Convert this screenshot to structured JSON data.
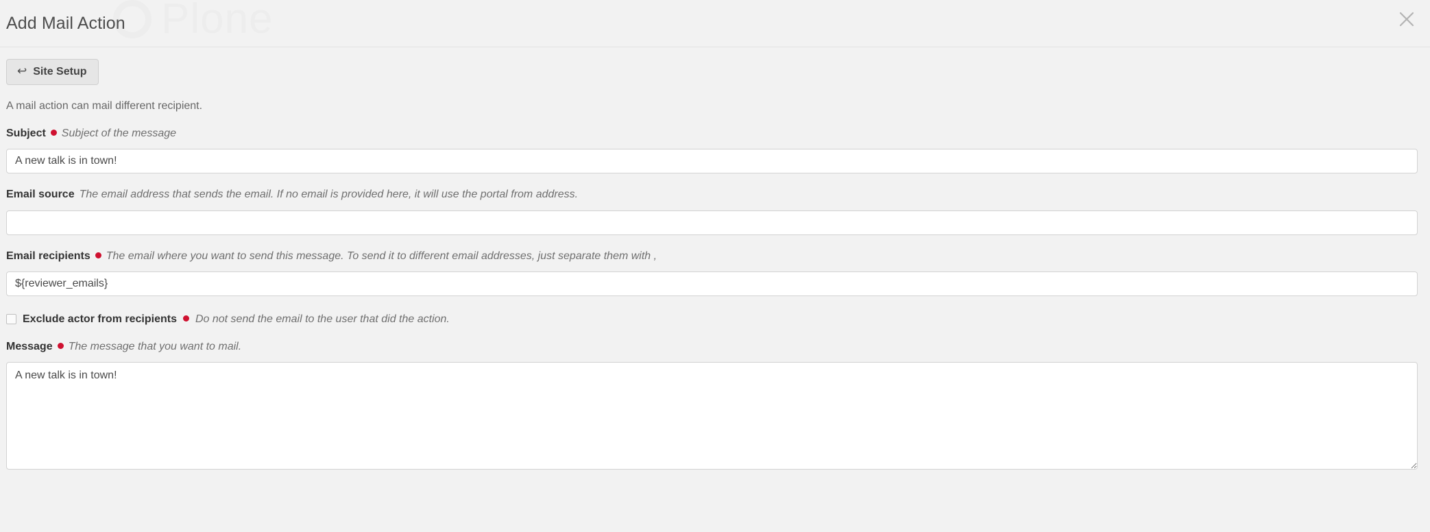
{
  "header": {
    "title": "Add Mail Action",
    "watermark_text": "Plone",
    "close_icon": "close-icon"
  },
  "breadcrumb": {
    "button_label": "Site Setup",
    "button_icon": "return-arrow-icon"
  },
  "form": {
    "description": "A mail action can mail different recipient.",
    "fields": [
      {
        "name": "subject",
        "label": "Subject",
        "required": true,
        "hint": "Subject of the message",
        "type": "text",
        "value": "A new talk is in town!",
        "placeholder": ""
      },
      {
        "name": "email_source",
        "label": "Email source",
        "required": false,
        "hint": "The email address that sends the email. If no email is provided here, it will use the portal from address.",
        "type": "text",
        "value": "",
        "placeholder": ""
      },
      {
        "name": "email_recipients",
        "label": "Email recipients",
        "required": true,
        "hint": "The email where you want to send this message. To send it to different email addresses, just separate them with ,",
        "type": "text",
        "value": "${reviewer_emails}",
        "placeholder": ""
      },
      {
        "name": "exclude_actor",
        "label": "Exclude actor from recipients",
        "required": true,
        "hint": "Do not send the email to the user that did the action.",
        "type": "checkbox",
        "checked": false
      },
      {
        "name": "message",
        "label": "Message",
        "required": true,
        "hint": "The message that you want to mail.",
        "type": "textarea",
        "value": "A new talk is in town!",
        "placeholder": ""
      }
    ]
  },
  "colors": {
    "required_marker": "#cf1130",
    "page_background": "#f2f2f2",
    "input_background": "#ffffff",
    "input_border": "#d2d2d2",
    "button_background": "#e6e6e6"
  }
}
